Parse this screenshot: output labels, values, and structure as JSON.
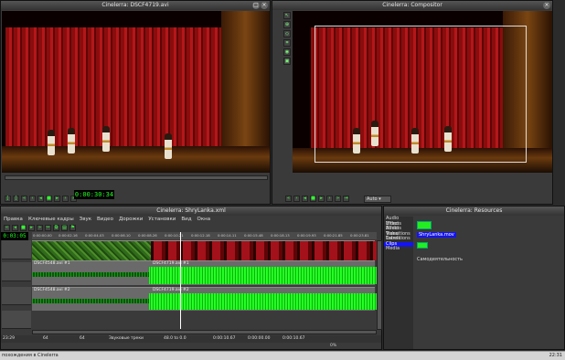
{
  "viewer": {
    "title": "Cinelerra: DSCF4719.avi",
    "timecode": "0:00:30:34"
  },
  "compositor": {
    "title": "Cinelerra: Compositor",
    "zoom": "Auto"
  },
  "resources": {
    "title": "Cinelerra: Resources",
    "folders": [
      "Audio Effects",
      "Video Effects",
      "Audio Transitions",
      "Video Transitions",
      "Labels",
      "Clips",
      "Media"
    ],
    "selected_folder": "Clips",
    "clip_name": "ShryLanka.mov",
    "description": "Самодеятельность"
  },
  "program": {
    "title": "Cinelerra: ShryLanka.xml",
    "menu": [
      "Правка",
      "Ключевые кадры",
      "Звук",
      "Видео",
      "Дорожки",
      "Установки",
      "Вид",
      "Окна"
    ],
    "timecode": "0:03:05",
    "ruler": [
      "0:00:00.00",
      "0:00:02.16",
      "0:00:04.03",
      "0:00:06.10",
      "0:00:08.26",
      "0:00:10.21",
      "0:00:12.18",
      "0:00:14.11",
      "0:00:15.48",
      "0:00:18.13",
      "0:00:19.93",
      "0:00:21.85",
      "0:00:23.81"
    ],
    "tracks": [
      {
        "label": "DSCF4548.avi #1",
        "label2": "DSCF4719.avi #1"
      },
      {
        "label": "DSCF4548.avi #2",
        "label2": "DSCF4719.avi #2"
      }
    ],
    "status": {
      "time": "23:29",
      "val1": "64",
      "val2": "64",
      "mode": "Звуковые треки",
      "range": "48.0 to 0.0",
      "pos1": "0:00:10.67",
      "pos2": "0:00:00.00",
      "pos3": "0:00:10.67",
      "zoom": "0%"
    }
  },
  "taskbar": {
    "label": "похождения в Cinelerra",
    "clock": "22:31"
  },
  "colors": {
    "accent_green": "#22ee22",
    "selection_blue": "#1414ee"
  }
}
